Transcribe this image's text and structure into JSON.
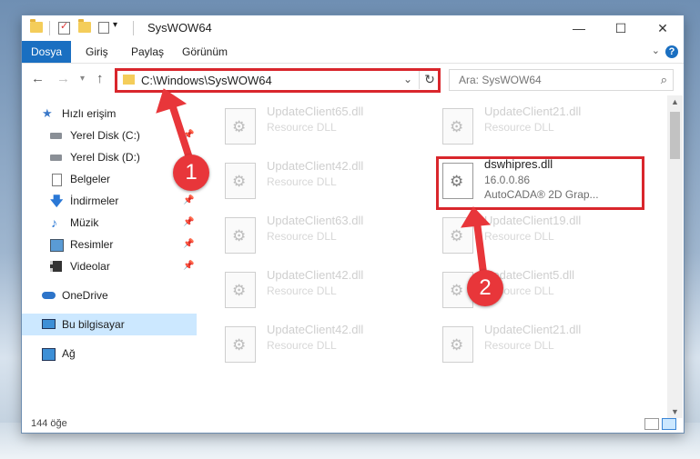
{
  "window": {
    "title": "SysWOW64"
  },
  "ribbon": {
    "tabs": [
      "Dosya",
      "Giriş",
      "Paylaş",
      "Görünüm"
    ],
    "help": "?"
  },
  "address": {
    "path": "C:\\Windows\\SysWOW64",
    "search_placeholder": "Ara: SysWOW64"
  },
  "nav_pane": {
    "items": [
      {
        "label": "Hızlı erişim",
        "icon": "star-icon"
      },
      {
        "label": "Yerel Disk (C:)",
        "icon": "drive-icon",
        "pinned": true
      },
      {
        "label": "Yerel Disk (D:)",
        "icon": "drive-icon"
      },
      {
        "label": "Belgeler",
        "icon": "document-icon",
        "pinned": true
      },
      {
        "label": "İndirmeler",
        "icon": "download-icon",
        "pinned": true
      },
      {
        "label": "Müzik",
        "icon": "music-icon",
        "pinned": true
      },
      {
        "label": "Resimler",
        "icon": "pictures-icon",
        "pinned": true
      },
      {
        "label": "Videolar",
        "icon": "video-icon",
        "pinned": true
      },
      {
        "label": "OneDrive",
        "icon": "cloud-icon"
      },
      {
        "label": "Bu bilgisayar",
        "icon": "computer-icon",
        "selected": true
      },
      {
        "label": "Ağ",
        "icon": "network-icon"
      }
    ]
  },
  "files": [
    {
      "name": "UpdateClient65.dll",
      "type": "Resource DLL"
    },
    {
      "name": "UpdateClient21.dll",
      "type": "Resource DLL"
    },
    {
      "name": "UpdateClient42.dll",
      "type": "Resource DLL"
    },
    {
      "name": "dswhipres.dll",
      "version": "16.0.0.86",
      "description": "AutoCADA® 2D Grap...",
      "highlighted": true
    },
    {
      "name": "UpdateClient63.dll",
      "type": "Resource DLL"
    },
    {
      "name": "UpdateClient19.dll",
      "type": "Resource DLL"
    },
    {
      "name": "UpdateClient42.dll",
      "type": "Resource DLL"
    },
    {
      "name": "UpdateClient5.dll",
      "type": "Resource DLL"
    },
    {
      "name": "UpdateClient42.dll",
      "type": "Resource DLL"
    },
    {
      "name": "UpdateClient21.dll",
      "type": "Resource DLL"
    }
  ],
  "status": {
    "item_count": "144 öğe"
  },
  "annotations": {
    "step1": "1",
    "step2": "2",
    "color": "#e8363a"
  }
}
